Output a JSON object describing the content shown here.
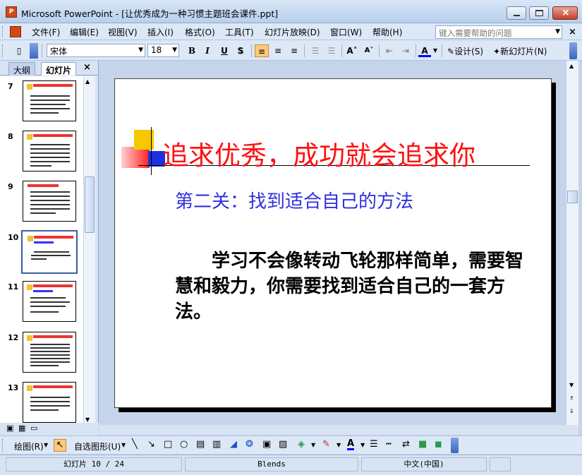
{
  "window": {
    "title": "Microsoft PowerPoint - [让优秀成为一种习惯主题班会课件.ppt]",
    "app_icon_label": "P"
  },
  "menu": {
    "items": [
      "文件(F)",
      "编辑(E)",
      "视图(V)",
      "插入(I)",
      "格式(O)",
      "工具(T)",
      "幻灯片放映(D)",
      "窗口(W)",
      "帮助(H)"
    ],
    "help_placeholder": "键入需要帮助的问题",
    "close_glyph": "×"
  },
  "toolbar": {
    "font_name": "宋体",
    "font_size": "18",
    "bold": "B",
    "italic": "I",
    "underline": "U",
    "shadow": "S",
    "design_label": "设计(S)",
    "new_slide_label": "新幻灯片(N)"
  },
  "left_panel": {
    "tab_outline": "大纲",
    "tab_slides": "幻灯片",
    "close_glyph": "×",
    "slides": [
      {
        "number": "7"
      },
      {
        "number": "8"
      },
      {
        "number": "9"
      },
      {
        "number": "10",
        "selected": true
      },
      {
        "number": "11"
      },
      {
        "number": "12"
      },
      {
        "number": "13"
      }
    ]
  },
  "slide": {
    "title": "追求优秀，成功就会追求你",
    "subtitle": "第二关：找到适合自己的方法",
    "body": "学习不会像转动飞轮那样简单，需要智慧和毅力，你需要找到适合自己的一套方法。"
  },
  "drawing_toolbar": {
    "draw_label": "绘图(R)",
    "autoshapes_label": "自选图形(U)"
  },
  "status": {
    "slide_info": "幻灯片 10 / 24",
    "design": "Blends",
    "language": "中文(中国)"
  },
  "colors": {
    "title_red": "#ff1010",
    "subtitle_blue": "#3030e0",
    "selection_blue": "#3c5e9e"
  }
}
